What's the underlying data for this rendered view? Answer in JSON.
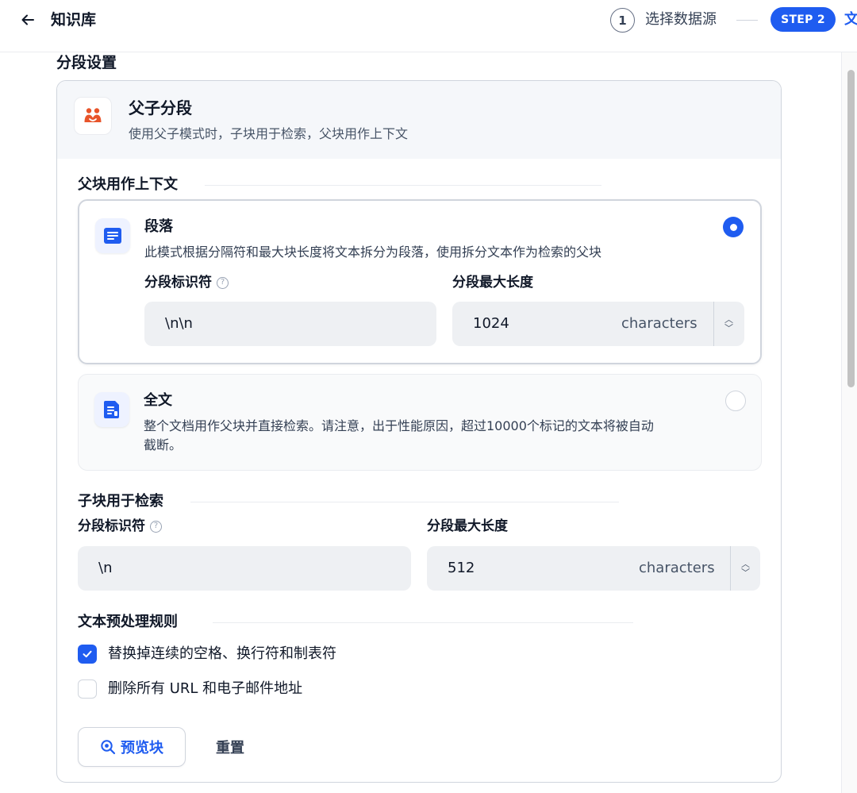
{
  "header": {
    "title": "知识库",
    "steps": [
      {
        "number": "1",
        "label": "选择数据源"
      },
      {
        "badge": "STEP 2",
        "label": "文"
      }
    ]
  },
  "section_title": "分段设置",
  "mode": {
    "title": "父子分段",
    "description": "使用父子模式时，子块用于检索，父块用作上下文"
  },
  "parent": {
    "group_title": "父块用作上下文",
    "options": [
      {
        "title": "段落",
        "description": "此模式根据分隔符和最大块长度将文本拆分为段落，使用拆分文本作为检索的父块",
        "selected": true,
        "separator_label": "分段标识符",
        "separator_value": "\\n\\n",
        "maxlen_label": "分段最大长度",
        "maxlen_value": "1024",
        "unit": "characters"
      },
      {
        "title": "全文",
        "description_line1": "整个文档用作父块并直接检索。请注意，出于性能原因，超过10000个标记的文本将被自动",
        "description_line2": "截断。",
        "selected": false
      }
    ]
  },
  "child": {
    "group_title": "子块用于检索",
    "separator_label": "分段标识符",
    "separator_value": "\\n",
    "maxlen_label": "分段最大长度",
    "maxlen_value": "512",
    "unit": "characters"
  },
  "preprocess": {
    "group_title": "文本预处理规则",
    "rules": [
      {
        "label": "替换掉连续的空格、换行符和制表符",
        "checked": true
      },
      {
        "label": "删除所有 URL 和电子邮件地址",
        "checked": false
      }
    ]
  },
  "actions": {
    "preview_label": "预览块",
    "reset_label": "重置"
  },
  "colors": {
    "accent": "#1f5cf0",
    "mode_icon": "#e8542a",
    "option_icon": "#1f5cf0"
  },
  "icons": {
    "back": "arrow-left-icon",
    "mode": "parent-child-icon",
    "paragraph": "paragraph-icon",
    "fulltext": "document-icon",
    "help": "question-circle-icon",
    "preview": "search-eye-icon"
  }
}
